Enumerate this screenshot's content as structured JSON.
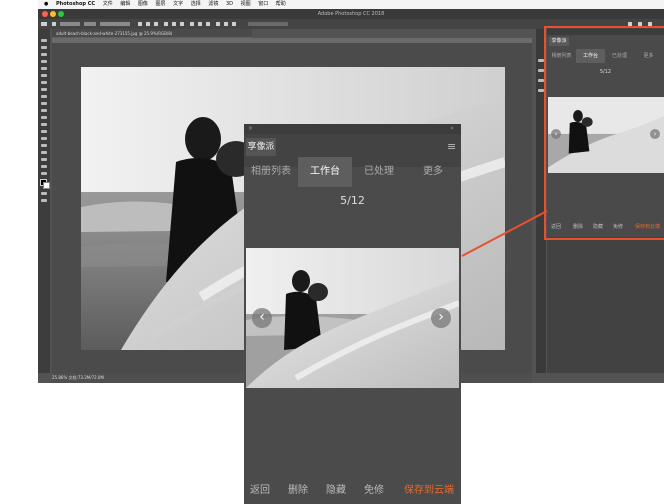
{
  "menubar": {
    "app": "Photoshop CC",
    "items": [
      "文件",
      "编辑",
      "图像",
      "图层",
      "文字",
      "选择",
      "滤镜",
      "3D",
      "视图",
      "窗口",
      "帮助"
    ]
  },
  "window": {
    "title": "Adobe Photoshop CC 2018",
    "doc_tab": "adult-beach-black-and-white-273155.jpg @ 25.9%(RGB/8)",
    "status": "25.86%   文档:73.2M/72.0M"
  },
  "plugin": {
    "name": "享像派",
    "tabs": [
      "相册列表",
      "工作台",
      "已处理",
      "更多"
    ],
    "active_tab": 1,
    "counter": "5/12",
    "footer": [
      "返回",
      "删除",
      "隐藏",
      "免修",
      "保存到云端"
    ],
    "nav_prev": "‹",
    "nav_next": "›",
    "menu_icon": "≡",
    "close_icon": "×",
    "collapse_icon": "«"
  },
  "colors": {
    "accent": "#e8502e",
    "panel_bg": "#4b4b4b",
    "save_color": "#e8692e"
  }
}
